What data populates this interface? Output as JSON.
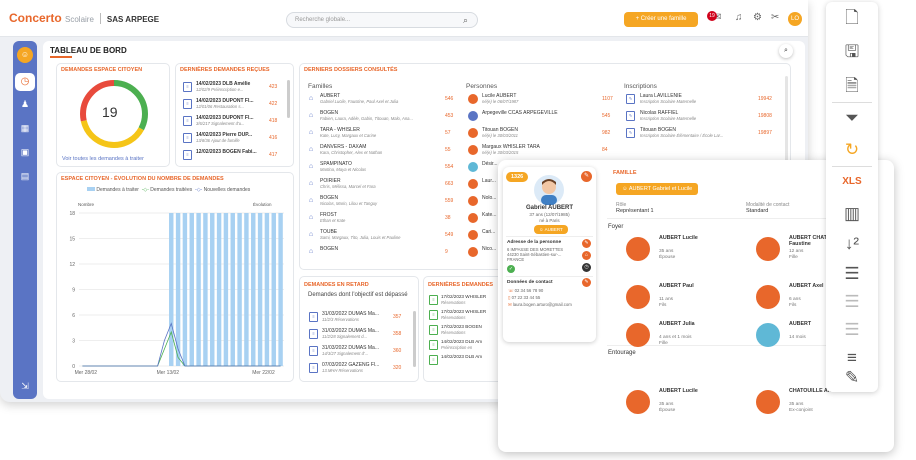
{
  "topbar": {
    "logo": "Concerto",
    "logo_sub": "Scolaire",
    "company": "SAS ARPEGE",
    "search_placeholder": "Recherche globale...",
    "create_button": "Créer une famille",
    "notif_count": "19",
    "avatar": "LO"
  },
  "page_title": "TABLEAU DE BORD",
  "citizen": {
    "title": "DEMANDES ESPACE CITOYEN",
    "count": "19",
    "link": "Voir toutes les demandes à traiter"
  },
  "last_requests": {
    "title": "DERNIÈRES DEMANDES REÇUES",
    "items": [
      {
        "title": "14/02/2023 DLB Amélie",
        "sub": "12/02/9 Préinscription e...",
        "count": "423"
      },
      {
        "title": "14/02/2023 DUPONT Fl...",
        "sub": "12/01/06 Restauration s...",
        "count": "422"
      },
      {
        "title": "14/02/2023 DUPONT Fl...",
        "sub": "3/6/217 Signalement d'u...",
        "count": "418"
      },
      {
        "title": "14/02/2023 Pierre DUP...",
        "sub": "13/8/36 Ajout de famille",
        "count": "416"
      },
      {
        "title": "12/02/2023 BOGEN Fabi...",
        "sub": "",
        "count": "417"
      }
    ]
  },
  "dossiers": {
    "title": "DERNIERS DOSSIERS CONSULTÉS",
    "familles_label": "Familles",
    "familles": [
      {
        "name": "AUBERT",
        "sub": "Gabriel Lucile, Faustine, Paul Axel et Julia",
        "n": "546"
      },
      {
        "name": "BOGEN",
        "sub": "Fabien, Laura, Adèle, Gabin, Titouan, Malo, Ana...",
        "n": "453"
      },
      {
        "name": "TARA - WHISLER",
        "sub": "Kate, Lucy, Margaux et Carine",
        "n": "57"
      },
      {
        "name": "DANVERS - DAXAM",
        "sub": "Kara, Christopher, Alex et Nathan",
        "n": "55"
      },
      {
        "name": "SPAMPINATO",
        "sub": "Martina, Maya et Nicolas",
        "n": "554"
      },
      {
        "name": "POIRIER",
        "sub": "Chris, Mélissa, Marcel et Fara",
        "n": "663"
      },
      {
        "name": "BOGEN",
        "sub": "Nicolas, Marin, Lilou et Tanguy",
        "n": "559"
      },
      {
        "name": "FROST",
        "sub": "Ethan et Kate",
        "n": "38"
      },
      {
        "name": "TOUBE",
        "sub": "Sami, Margaux, Tito, Julia, Louis et Pauline",
        "n": "549"
      },
      {
        "name": "BOGEN",
        "sub": "",
        "n": "9"
      }
    ],
    "personnes_label": "Personnes",
    "personnes": [
      {
        "name": "Lucile AUBERT",
        "sub": "né(e) le 06/07/1987",
        "n": "1107"
      },
      {
        "name": "Arpegeville CCAS ARPEGEVILLE",
        "sub": "",
        "n": "545"
      },
      {
        "name": "Titouan BOGEN",
        "sub": "né(e) le 30/03/2011",
        "n": "982"
      },
      {
        "name": "Margaux WHISLER TARA",
        "sub": "né(e) le 30/03/2015",
        "n": "84"
      },
      {
        "name": "Désir...",
        "sub": "",
        "n": ""
      },
      {
        "name": "Laur...",
        "sub": "",
        "n": ""
      },
      {
        "name": "Nolo...",
        "sub": "",
        "n": ""
      },
      {
        "name": "Kate...",
        "sub": "",
        "n": ""
      },
      {
        "name": "Cari...",
        "sub": "",
        "n": ""
      },
      {
        "name": "Nico...",
        "sub": "",
        "n": ""
      }
    ],
    "inscriptions_label": "Inscriptions",
    "inscriptions": [
      {
        "name": "Laura LAVILLENIE",
        "sub": "Inscription Scolaire Maternelle",
        "n": "19942"
      },
      {
        "name": "Nicolas RAFFIEL",
        "sub": "Inscription Scolaire Maternelle",
        "n": "19808"
      },
      {
        "name": "Titouan BOGEN",
        "sub": "Inscription Scolaire Élémentaire / École Lar...",
        "n": "19897"
      }
    ]
  },
  "evolution": {
    "title": "ESPACE CITOYEN - ÉVOLUTION DU NOMBRE DE DEMANDES",
    "legend": [
      "Demandes à traiter",
      "Demandes traitées",
      "Nouvelles demandes"
    ],
    "left_label": "Nombre",
    "right_label": "Évolution"
  },
  "late": {
    "title": "DEMANDES EN RETARD",
    "subtitle": "Demandes dont l'objectif est dépassé",
    "items": [
      {
        "title": "31/03/2022 DUMAS Ma...",
        "sub": "11/2/3 Réservations",
        "n": "357"
      },
      {
        "title": "31/03/2022 DUMAS Ma...",
        "sub": "11/2/28 Signalement d...",
        "n": "358"
      },
      {
        "title": "31/03/2022 DUMAS Ma...",
        "sub": "14/3/27 Signalement d'...",
        "n": "360"
      },
      {
        "title": "07/03/2022 GAZENG Fl...",
        "sub": "13.MHH Réservations",
        "n": "320"
      }
    ]
  },
  "last2": {
    "title": "DERNIÈRES DEMANDES",
    "items": [
      {
        "title": "17/02/2023 WHISLER",
        "sub": "Réservations"
      },
      {
        "title": "17/02/2023 WHISLER",
        "sub": "Réservations"
      },
      {
        "title": "17/02/2023 BOGEN",
        "sub": "Réservations"
      },
      {
        "title": "14/02/2023 DLB Am",
        "sub": "Préinscription en"
      },
      {
        "title": "14/02/2023 DLB Am",
        "sub": ""
      }
    ]
  },
  "person_card": {
    "id": "1326",
    "name": "Gabriel AUBERT",
    "age": "37 ans (12/07/1985)",
    "born": "né à Paris",
    "tag": "AUBERT",
    "addr_label": "Adresse de la personne",
    "addr": "6 IMPASSE DES MORETTES 44230 Saint-Sébastien-sur-... FRANCE",
    "contact_label": "Données de contact",
    "phone1": "02 34 56 78 90",
    "phone2": "07 22 33 44 55",
    "email": "laura.bogen.arturo@gmail.com"
  },
  "family": {
    "label": "FAMILLE",
    "tag": "AUBERT Gabriel et Lucile",
    "role_label": "Rôle",
    "role": "Représentant 1",
    "contact_mode_label": "Modalité de contact",
    "contact_mode": "Standard",
    "foyer": "Foyer",
    "members": [
      {
        "name": "AUBERT Lucile",
        "l1": "35 ans",
        "l2": "Épouse"
      },
      {
        "name": "AUBERT CHATOUILLE Faustine",
        "l1": "12 ans",
        "l2": "Fille"
      },
      {
        "name": "AUBERT Paul",
        "l1": "11 ans",
        "l2": "Fils"
      },
      {
        "name": "AUBERT Axel",
        "l1": "6 ans",
        "l2": "Fils"
      },
      {
        "name": "AUBERT Julia",
        "l1": "4 ans et 1 mois",
        "l2": "Fille"
      },
      {
        "name": "AUBERT",
        "l1": "14 mois",
        "l2": ""
      }
    ],
    "entourage": "Entourage",
    "ent_members": [
      {
        "name": "AUBERT Lucile",
        "l1": "35 ans",
        "l2": "Épouse"
      },
      {
        "name": "CHATOUILLE Amél...",
        "l1": "35 ans",
        "l2": "Ex-conjoint"
      }
    ]
  },
  "chart_data": {
    "type": "bar",
    "title": "ESPACE CITOYEN - ÉVOLUTION DU NOMBRE DE DEMANDES",
    "x_ticks": [
      "Mer 28/02",
      "Mer 13/02",
      "Mer 22/02"
    ],
    "ylim": [
      0,
      18
    ],
    "y_ticks": [
      0,
      3,
      6,
      9,
      12,
      15,
      18
    ],
    "series": [
      {
        "name": "Demandes à traiter",
        "values": [
          0,
          0,
          0,
          0,
          0,
          0,
          0,
          0,
          0,
          0,
          0,
          0,
          0,
          18,
          18,
          18,
          18,
          18,
          18,
          18,
          18,
          18,
          18,
          18,
          18,
          18,
          18,
          18,
          18,
          18
        ]
      },
      {
        "name": "Demandes traitées",
        "values": [
          0,
          0,
          0,
          0,
          0,
          0,
          0,
          0,
          0,
          0,
          0,
          0,
          2,
          4,
          1,
          0,
          0,
          0,
          0,
          0,
          0,
          0,
          0,
          0,
          0,
          0,
          0,
          0,
          0,
          0
        ]
      },
      {
        "name": "Nouvelles demandes",
        "values": [
          0,
          0,
          0,
          0,
          0,
          0,
          0,
          0,
          0,
          0,
          0,
          0,
          3,
          5,
          2,
          0,
          0,
          0,
          0,
          0,
          0,
          0,
          0,
          0,
          0,
          0,
          0,
          0,
          0,
          0
        ]
      }
    ]
  },
  "colors": {
    "accent": "#e8672b",
    "blue": "#5a74c4",
    "bar": "#a8d1f2",
    "green": "#4caf50",
    "orange": "#f5a623"
  }
}
